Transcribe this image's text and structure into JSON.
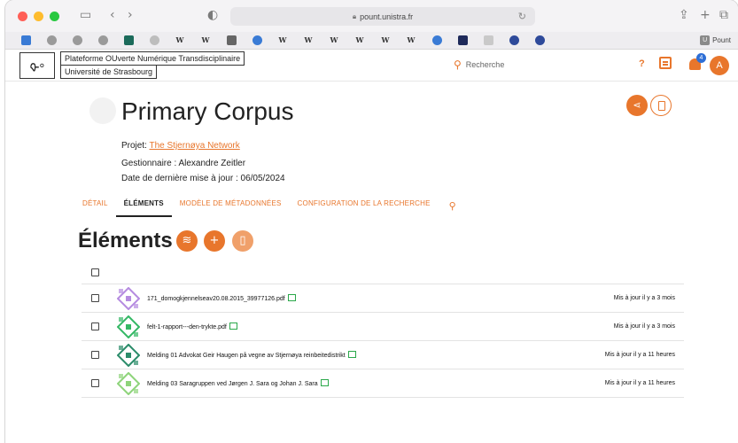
{
  "browser": {
    "url": "pount.unistra.fr",
    "favorites_last_label": "Pount"
  },
  "header": {
    "platform_name": "Plateforme OUverte Numérique Transdisciplinaire",
    "university": "Université de Strasbourg",
    "search_placeholder": "Recherche",
    "help_label": "?",
    "notification_count": "4",
    "avatar_initial": "A"
  },
  "corpus": {
    "title": "Primary Corpus",
    "project_label": "Projet: ",
    "project_link": "The Stjernøya Network",
    "manager": "Gestionnaire : Alexandre Zeitler",
    "last_update": "Date de dernière mise à jour : 06/05/2024"
  },
  "tabs": [
    {
      "label": "DÉTAIL"
    },
    {
      "label": "ÉLÉMENTS"
    },
    {
      "label": "MODÈLE DE MÉTADONNÉES"
    },
    {
      "label": "CONFIGURATION DE LA RECHERCHE"
    }
  ],
  "elements": {
    "title": "Éléments",
    "items": [
      {
        "name": "171_domogkjennelseav20.08.2015_39977126.pdf",
        "updated": "Mis à jour il y a 3 mois",
        "color": "#b58be0"
      },
      {
        "name": "felt-1-rapport---den-trykte.pdf",
        "updated": "Mis à jour il y a 3 mois",
        "color": "#35b865"
      },
      {
        "name": "Melding 01 Advokat Geir Haugen på vegne av Stjernøya reinbeitedistrikt",
        "updated": "Mis à jour il y a 11 heures",
        "color": "#2b8c6a"
      },
      {
        "name": "Melding 03 Saragruppen ved Jørgen J. Sara og Johan J. Sara",
        "updated": "Mis à jour il y a 11 heures",
        "color": "#8ed47a"
      }
    ]
  },
  "colors": {
    "accent": "#e8762c"
  }
}
